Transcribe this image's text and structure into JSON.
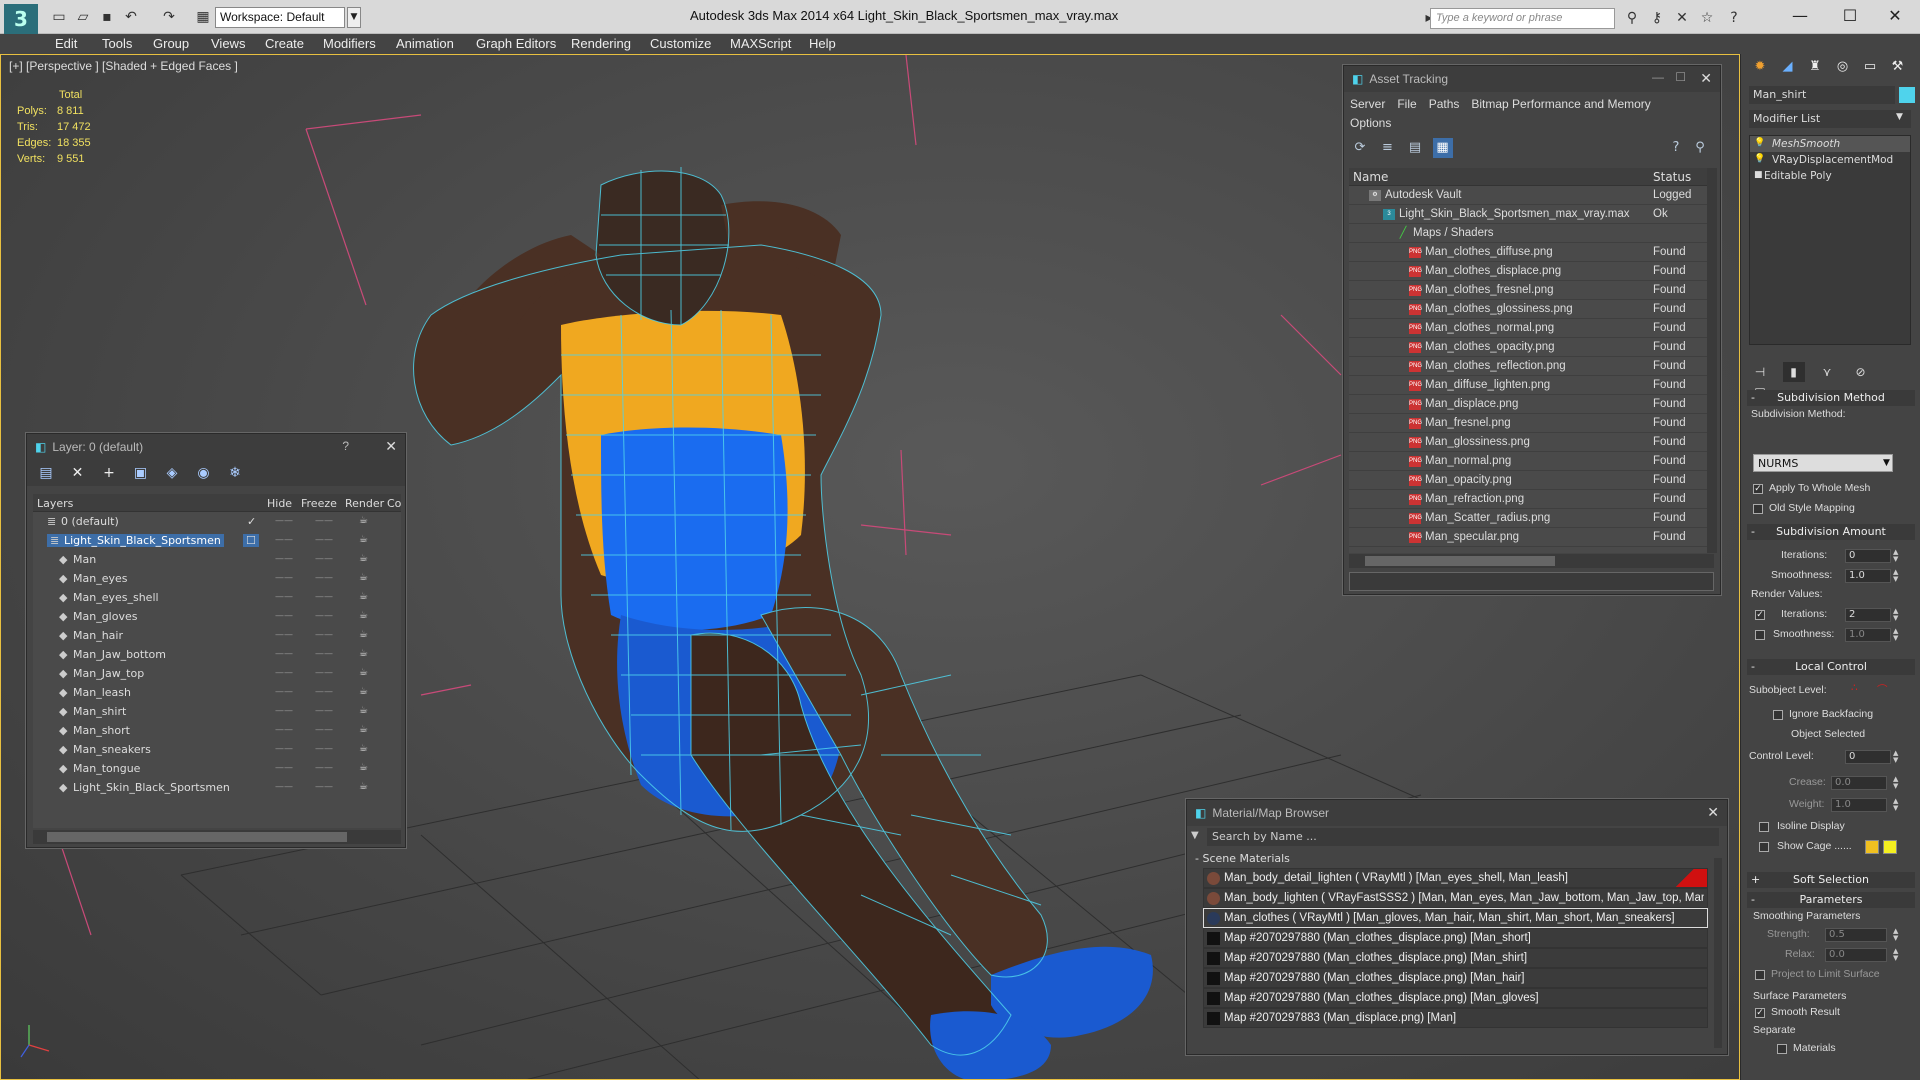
{
  "app": {
    "logo_letter": "3",
    "window_title": "Autodesk 3ds Max  2014 x64     Light_Skin_Black_Sportsmen_max_vray.max",
    "workspace_label": "Workspace: Default",
    "keyword_search_placeholder": "Type a keyword or phrase",
    "window_controls": {
      "minimize": "—",
      "maximize": "☐",
      "close": "✕"
    }
  },
  "menu": [
    "Edit",
    "Tools",
    "Group",
    "Views",
    "Create",
    "Modifiers",
    "Animation",
    "Graph Editors",
    "Rendering",
    "Customize",
    "MAXScript",
    "Help"
  ],
  "viewport": {
    "label": "[+] [Perspective ] [Shaded + Edged Faces ]",
    "stats": {
      "header": "Total",
      "rows": [
        {
          "label": "Polys:",
          "value": "8 811"
        },
        {
          "label": "Tris:",
          "value": "17 472"
        },
        {
          "label": "Edges:",
          "value": "18 355"
        },
        {
          "label": "Verts:",
          "value": "9 551"
        }
      ]
    },
    "colors": {
      "wire": "#4fd3ec",
      "grid": "#2a2a2a",
      "accent": "#e8c040",
      "frame": "#c84a78"
    }
  },
  "layer_panel": {
    "title": "Layer: 0 (default)",
    "help": "?",
    "close": "✕",
    "columns": [
      "Layers",
      "Hide",
      "Freeze",
      "Render",
      "Co"
    ],
    "rows": [
      {
        "name": "0 (default)",
        "level": 1,
        "kind": "layer"
      },
      {
        "name": "Light_Skin_Black_Sportsmen",
        "level": 1,
        "kind": "layer",
        "selected": true
      },
      {
        "name": "Man",
        "level": 2,
        "kind": "obj"
      },
      {
        "name": "Man_eyes",
        "level": 2,
        "kind": "obj"
      },
      {
        "name": "Man_eyes_shell",
        "level": 2,
        "kind": "obj"
      },
      {
        "name": "Man_gloves",
        "level": 2,
        "kind": "obj"
      },
      {
        "name": "Man_hair",
        "level": 2,
        "kind": "obj"
      },
      {
        "name": "Man_Jaw_bottom",
        "level": 2,
        "kind": "obj"
      },
      {
        "name": "Man_Jaw_top",
        "level": 2,
        "kind": "obj"
      },
      {
        "name": "Man_leash",
        "level": 2,
        "kind": "obj"
      },
      {
        "name": "Man_shirt",
        "level": 2,
        "kind": "obj"
      },
      {
        "name": "Man_short",
        "level": 2,
        "kind": "obj"
      },
      {
        "name": "Man_sneakers",
        "level": 2,
        "kind": "obj"
      },
      {
        "name": "Man_tongue",
        "level": 2,
        "kind": "obj"
      },
      {
        "name": "Light_Skin_Black_Sportsmen",
        "level": 2,
        "kind": "obj"
      }
    ]
  },
  "asset_panel": {
    "title": "Asset Tracking",
    "menu": [
      "Server",
      "File",
      "Paths",
      "Bitmap Performance and Memory",
      "Options"
    ],
    "columns": [
      "Name",
      "Status"
    ],
    "rows": [
      {
        "name": "Autodesk Vault",
        "status": "Logged",
        "level": 1,
        "icon": "vault"
      },
      {
        "name": "Light_Skin_Black_Sportsmen_max_vray.max",
        "status": "Ok",
        "level": 2,
        "icon": "max"
      },
      {
        "name": "Maps / Shaders",
        "status": "",
        "level": 3,
        "icon": "folder"
      },
      {
        "name": "Man_clothes_diffuse.png",
        "status": "Found",
        "level": 4,
        "icon": "png"
      },
      {
        "name": "Man_clothes_displace.png",
        "status": "Found",
        "level": 4,
        "icon": "png"
      },
      {
        "name": "Man_clothes_fresnel.png",
        "status": "Found",
        "level": 4,
        "icon": "png"
      },
      {
        "name": "Man_clothes_glossiness.png",
        "status": "Found",
        "level": 4,
        "icon": "png"
      },
      {
        "name": "Man_clothes_normal.png",
        "status": "Found",
        "level": 4,
        "icon": "png"
      },
      {
        "name": "Man_clothes_opacity.png",
        "status": "Found",
        "level": 4,
        "icon": "png"
      },
      {
        "name": "Man_clothes_reflection.png",
        "status": "Found",
        "level": 4,
        "icon": "png"
      },
      {
        "name": "Man_diffuse_lighten.png",
        "status": "Found",
        "level": 4,
        "icon": "png"
      },
      {
        "name": "Man_displace.png",
        "status": "Found",
        "level": 4,
        "icon": "png"
      },
      {
        "name": "Man_fresnel.png",
        "status": "Found",
        "level": 4,
        "icon": "png"
      },
      {
        "name": "Man_glossiness.png",
        "status": "Found",
        "level": 4,
        "icon": "png"
      },
      {
        "name": "Man_normal.png",
        "status": "Found",
        "level": 4,
        "icon": "png"
      },
      {
        "name": "Man_opacity.png",
        "status": "Found",
        "level": 4,
        "icon": "png"
      },
      {
        "name": "Man_refraction.png",
        "status": "Found",
        "level": 4,
        "icon": "png"
      },
      {
        "name": "Man_Scatter_radius.png",
        "status": "Found",
        "level": 4,
        "icon": "png"
      },
      {
        "name": "Man_specular.png",
        "status": "Found",
        "level": 4,
        "icon": "png"
      }
    ]
  },
  "material_browser": {
    "title": "Material/Map Browser",
    "search_placeholder": "Search by Name ...",
    "group": "- Scene Materials",
    "rows": [
      {
        "text": "Man_body_detail_lighten  ( VRayMtl ) [Man_eyes_shell, Man_leash]",
        "kind": "mtl",
        "flag": true
      },
      {
        "text": "Man_body_lighten  ( VRayFastSSS2 ) [Man, Man_eyes, Man_Jaw_bottom, Man_Jaw_top, Man...",
        "kind": "mtl"
      },
      {
        "text": "Man_clothes  ( VRayMtl ) [Man_gloves, Man_hair, Man_shirt, Man_short, Man_sneakers]",
        "kind": "mtl",
        "selected": true
      },
      {
        "text": "Map #2070297880 (Man_clothes_displace.png) [Man_short]",
        "kind": "map"
      },
      {
        "text": "Map #2070297880 (Man_clothes_displace.png) [Man_shirt]",
        "kind": "map"
      },
      {
        "text": "Map #2070297880 (Man_clothes_displace.png) [Man_hair]",
        "kind": "map"
      },
      {
        "text": "Map #2070297880 (Man_clothes_displace.png) [Man_gloves]",
        "kind": "map"
      },
      {
        "text": "Map #2070297883 (Man_displace.png) [Man]",
        "kind": "map"
      }
    ]
  },
  "command_panel": {
    "object_name": "Man_shirt",
    "object_color": "#4fd3ec",
    "modifier_list_label": "Modifier List",
    "stack": [
      {
        "name": "MeshSmooth",
        "selected": true
      },
      {
        "name": "VRayDisplacementMod"
      },
      {
        "name": "Editable Poly"
      }
    ],
    "rollouts": {
      "subdivision_method": {
        "title": "Subdivision Method",
        "method_label": "Subdivision Method:",
        "method_value": "NURMS",
        "apply_whole_mesh": "Apply To Whole Mesh",
        "old_style": "Old Style Mapping"
      },
      "subdivision_amount": {
        "title": "Subdivision Amount",
        "iterations_label": "Iterations:",
        "iterations_value": "0",
        "smoothness_label": "Smoothness:",
        "smoothness_value": "1.0",
        "render_values": "Render Values:",
        "r_iterations_label": "Iterations:",
        "r_iterations_value": "2",
        "r_smoothness_label": "Smoothness:",
        "r_smoothness_value": "1.0"
      },
      "local_control": {
        "title": "Local Control",
        "subobject_label": "Subobject Level:",
        "ignore_backfacing": "Ignore Backfacing",
        "object_selected": "Object Selected",
        "control_level_label": "Control Level:",
        "control_level_value": "0",
        "crease_label": "Crease:",
        "crease_value": "0.0",
        "weight_label": "Weight:",
        "weight_value": "1.0",
        "isoline": "Isoline Display",
        "show_cage": "Show Cage ......"
      },
      "soft_selection": {
        "title": "Soft Selection"
      },
      "parameters": {
        "title": "Parameters",
        "smoothing_params": "Smoothing Parameters",
        "strength_label": "Strength:",
        "strength_value": "0.5",
        "relax_label": "Relax:",
        "relax_value": "0.0",
        "project_limit": "Project to Limit Surface",
        "surface_params": "Surface Parameters",
        "smooth_result": "Smooth Result",
        "separate": "Separate",
        "materials": "Materials"
      }
    }
  }
}
